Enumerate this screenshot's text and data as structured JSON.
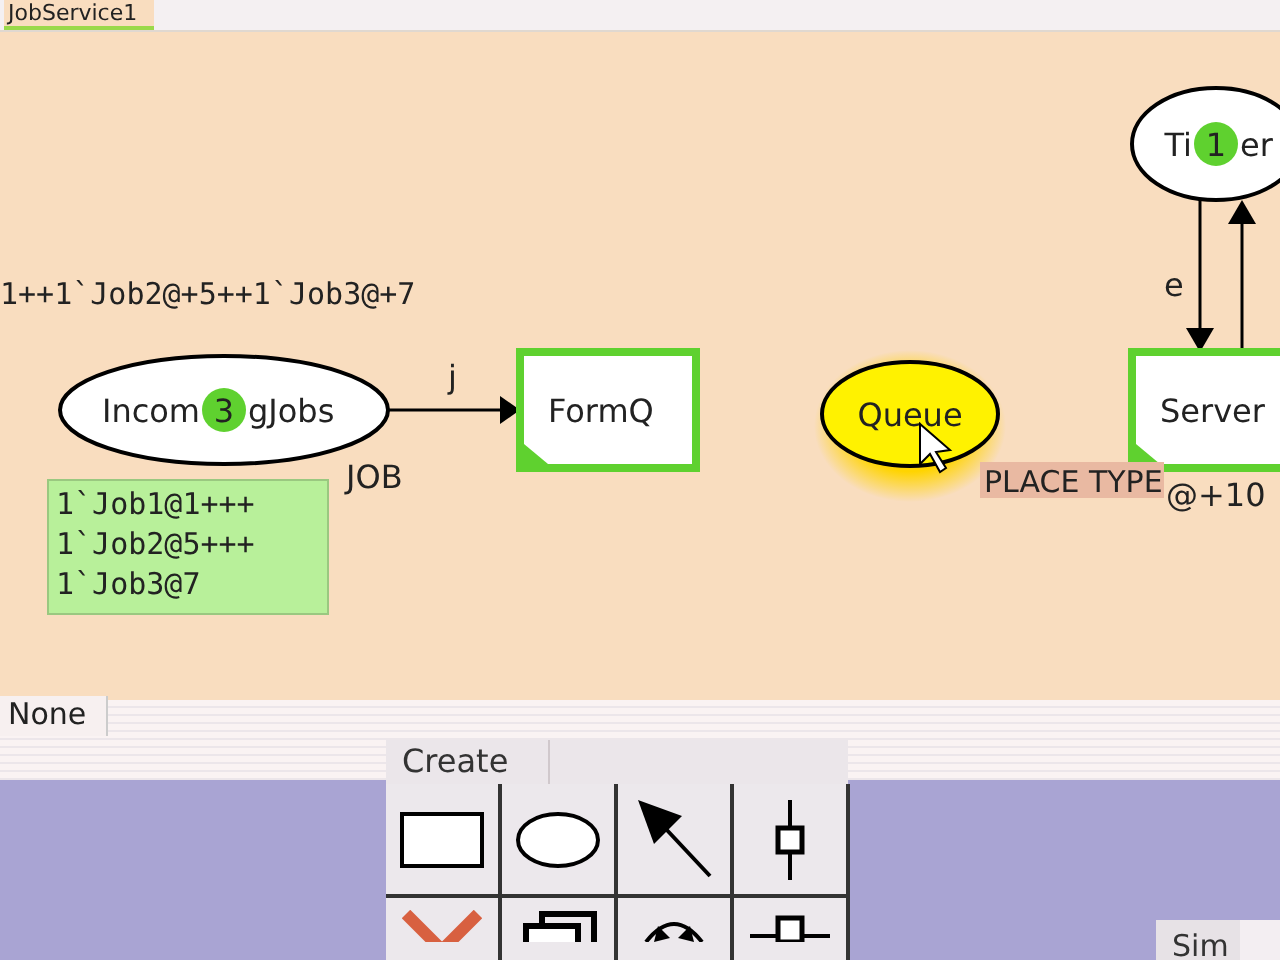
{
  "tab": {
    "label": "JobService1",
    "selected": true
  },
  "declaration_text": "1++1`Job2@+5++1`Job3@+7",
  "places": [
    {
      "name_parts": [
        "Incom",
        "gJobs"
      ],
      "tokens": "3",
      "highlighted": false,
      "selected": false,
      "type": "JOB",
      "marking": [
        "1`Job1@1+++",
        "1`Job2@5+++",
        "1`Job3@7"
      ]
    },
    {
      "name_parts": [
        "Queue"
      ],
      "highlighted": false,
      "selected": true
    },
    {
      "name_parts": [
        "Ti",
        "er"
      ],
      "tokens": "1",
      "highlighted": false,
      "selected": false
    }
  ],
  "transitions": [
    {
      "name": "FormQ",
      "enabled": true
    },
    {
      "name": "Server",
      "enabled": true,
      "time": "@+10"
    }
  ],
  "arcs": [
    {
      "inscription": "j"
    },
    {
      "inscription": "e"
    }
  ],
  "tooltip": "PLACE TYPE",
  "bottom_tab": {
    "label": "None",
    "selected": true
  },
  "palette": {
    "title": "Create"
  },
  "sim_tab": "Sim"
}
